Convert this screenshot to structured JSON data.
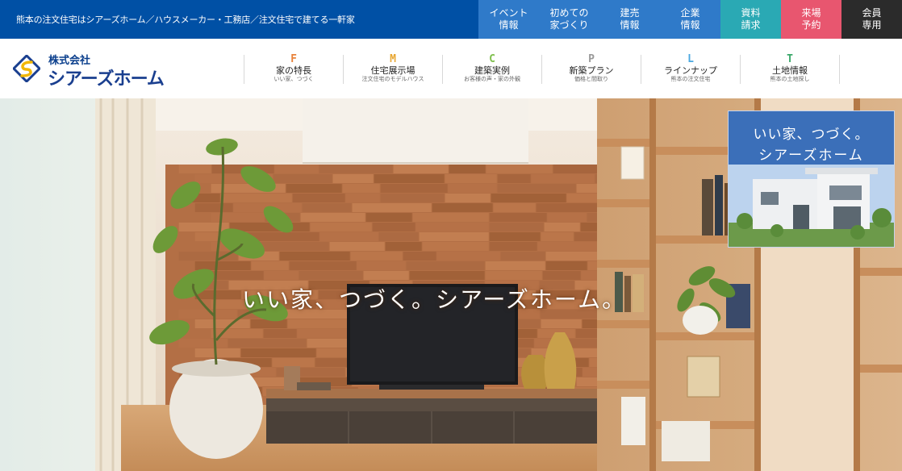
{
  "topbar": {
    "tagline": "熊本の注文住宅はシアーズホーム／ハウスメーカー・工務店／注文住宅で建てる一軒家",
    "nav": [
      {
        "label": "イベント\n情報",
        "color": "#2f7ac9"
      },
      {
        "label": "初めての\n家づくり",
        "color": "#2f7ac9"
      },
      {
        "label": "建売\n情報",
        "color": "#2f7ac9"
      },
      {
        "label": "企業\n情報",
        "color": "#2f7ac9"
      },
      {
        "label": "資料\n請求",
        "color": "#2aa9b4"
      },
      {
        "label": "来場\n予約",
        "color": "#e8566f"
      },
      {
        "label": "会員\n専用",
        "color": "#2b2b2b"
      }
    ]
  },
  "header": {
    "logo_small": "株式会社",
    "logo_big": "シアーズホーム",
    "nav": [
      {
        "letter": "F",
        "label": "家の特長",
        "sub": "いい家、つづく",
        "color": "#e8823a"
      },
      {
        "letter": "M",
        "label": "住宅展示場",
        "sub": "注文住宅のモデルハウス",
        "color": "#e8a732"
      },
      {
        "letter": "C",
        "label": "建築実例",
        "sub": "お客様の声・家の外観",
        "color": "#7fbf4d"
      },
      {
        "letter": "P",
        "label": "新築プラン",
        "sub": "価格と間取り",
        "color": "#999999"
      },
      {
        "letter": "L",
        "label": "ラインナップ",
        "sub": "熊本の注文住宅",
        "color": "#4aa8e0"
      },
      {
        "letter": "T",
        "label": "土地情報",
        "sub": "熊本の土地探し",
        "color": "#3aa86a"
      }
    ]
  },
  "hero": {
    "copy": "いい家、つづく。シアーズホーム。"
  },
  "promo": {
    "line1": "いい家、つづく。",
    "line2": "シアーズホーム"
  }
}
